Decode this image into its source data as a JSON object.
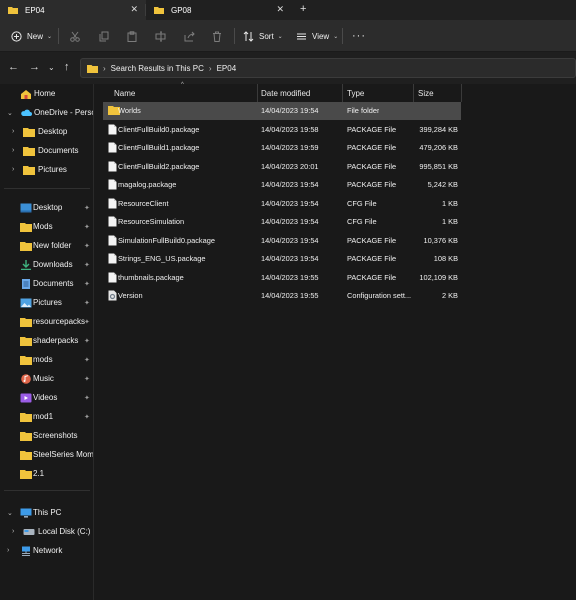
{
  "tabs": [
    {
      "label": "EP04",
      "close": "✕"
    },
    {
      "label": "GP08",
      "close": "✕"
    }
  ],
  "tab_add": "+",
  "toolbar": {
    "new_label": "New",
    "sort_label": "Sort",
    "view_label": "View",
    "more": "···",
    "caret": "⌄"
  },
  "nav": {
    "back": "←",
    "forward": "→",
    "recent": "⌄",
    "up": "↑"
  },
  "address": {
    "separator": "›",
    "crumbs": [
      "Search Results in This PC",
      "EP04"
    ]
  },
  "sidebar": {
    "chev_right": "›",
    "chev_down": "⌄",
    "pin": "📌",
    "items": [
      {
        "label": "Home",
        "icon": "home-icon"
      },
      {
        "label": "OneDrive - Personal",
        "icon": "cloud-icon"
      },
      {
        "label": "Desktop",
        "icon": "folder-icon"
      },
      {
        "label": "Documents",
        "icon": "folder-icon"
      },
      {
        "label": "Pictures",
        "icon": "folder-icon"
      },
      {
        "label": "Desktop",
        "icon": "desktop-icon"
      },
      {
        "label": "Mods",
        "icon": "folder-icon"
      },
      {
        "label": "New folder",
        "icon": "folder-icon"
      },
      {
        "label": "Downloads",
        "icon": "download-icon"
      },
      {
        "label": "Documents",
        "icon": "documents-icon"
      },
      {
        "label": "Pictures",
        "icon": "pictures-icon"
      },
      {
        "label": "resourcepacks",
        "icon": "folder-icon"
      },
      {
        "label": "shaderpacks",
        "icon": "folder-icon"
      },
      {
        "label": "mods",
        "icon": "folder-icon"
      },
      {
        "label": "Music",
        "icon": "music-icon"
      },
      {
        "label": "Videos",
        "icon": "videos-icon"
      },
      {
        "label": "mod1",
        "icon": "folder-icon"
      },
      {
        "label": "Screenshots",
        "icon": "folder-icon"
      },
      {
        "label": "SteelSeries Moments",
        "icon": "folder-icon"
      },
      {
        "label": "2.1",
        "icon": "folder-icon"
      },
      {
        "label": "This PC",
        "icon": "pc-icon"
      },
      {
        "label": "Local Disk (C:)",
        "icon": "disk-icon"
      },
      {
        "label": "Network",
        "icon": "network-icon"
      }
    ]
  },
  "columns": {
    "name": "Name",
    "date": "Date modified",
    "type": "Type",
    "size": "Size",
    "sort_caret": "^"
  },
  "files": [
    {
      "name": "Worlds",
      "date": "14/04/2023 19:54",
      "type": "File folder",
      "size": "",
      "icon": "folder-icon"
    },
    {
      "name": "ClientFullBuild0.package",
      "date": "14/04/2023 19:58",
      "type": "PACKAGE File",
      "size": "399,284 KB",
      "icon": "file-icon"
    },
    {
      "name": "ClientFullBuild1.package",
      "date": "14/04/2023 19:59",
      "type": "PACKAGE File",
      "size": "479,206 KB",
      "icon": "file-icon"
    },
    {
      "name": "ClientFullBuild2.package",
      "date": "14/04/2023 20:01",
      "type": "PACKAGE File",
      "size": "995,851 KB",
      "icon": "file-icon"
    },
    {
      "name": "magalog.package",
      "date": "14/04/2023 19:54",
      "type": "PACKAGE File",
      "size": "5,242 KB",
      "icon": "file-icon"
    },
    {
      "name": "ResourceClient",
      "date": "14/04/2023 19:54",
      "type": "CFG File",
      "size": "1 KB",
      "icon": "file-icon"
    },
    {
      "name": "ResourceSimulation",
      "date": "14/04/2023 19:54",
      "type": "CFG File",
      "size": "1 KB",
      "icon": "file-icon"
    },
    {
      "name": "SimulationFullBuild0.package",
      "date": "14/04/2023 19:54",
      "type": "PACKAGE File",
      "size": "10,376 KB",
      "icon": "file-icon"
    },
    {
      "name": "Strings_ENG_US.package",
      "date": "14/04/2023 19:54",
      "type": "PACKAGE File",
      "size": "108 KB",
      "icon": "file-icon"
    },
    {
      "name": "thumbnails.package",
      "date": "14/04/2023 19:55",
      "type": "PACKAGE File",
      "size": "102,109 KB",
      "icon": "file-icon"
    },
    {
      "name": "Version",
      "date": "14/04/2023 19:55",
      "type": "Configuration sett...",
      "size": "2 KB",
      "icon": "config-file-icon"
    }
  ],
  "colors": {
    "folder": "#f0c33c",
    "accent": "#4cc2ff",
    "selected_row": "#4a4a4a"
  }
}
